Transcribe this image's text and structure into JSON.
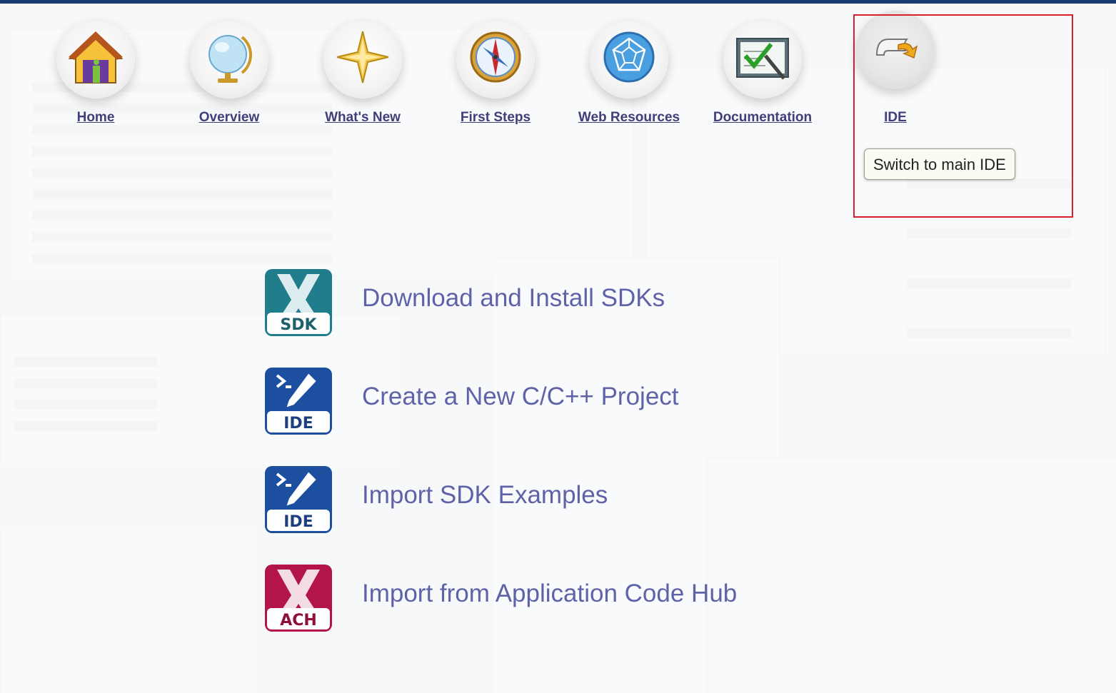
{
  "nav": {
    "items": [
      {
        "label": "Home",
        "icon": "home-icon"
      },
      {
        "label": "Overview",
        "icon": "globe-icon"
      },
      {
        "label": "What's New",
        "icon": "star-icon"
      },
      {
        "label": "First Steps",
        "icon": "compass-icon"
      },
      {
        "label": "Web Resources",
        "icon": "web-icon"
      },
      {
        "label": "Documentation",
        "icon": "documentation-icon"
      },
      {
        "label": "IDE",
        "icon": "switch-ide-icon"
      }
    ]
  },
  "tooltip": {
    "text": "Switch to main IDE"
  },
  "actions": {
    "items": [
      {
        "label": "Download and Install SDKs",
        "badge": "SDK",
        "icon": "sdk-icon",
        "color": "#1f7d8c"
      },
      {
        "label": "Create a New C/C++ Project",
        "badge": "IDE",
        "icon": "ide-icon",
        "color": "#1d4fa0"
      },
      {
        "label": "Import SDK Examples",
        "badge": "IDE",
        "icon": "ide-icon",
        "color": "#1d4fa0"
      },
      {
        "label": "Import from Application Code Hub",
        "badge": "ACH",
        "icon": "ach-icon",
        "color": "#b3154a"
      }
    ]
  },
  "colors": {
    "accent_bar": "#1b3b73",
    "highlight": "#d9202a",
    "link": "#3f3f7a",
    "action_text": "#5e63a8"
  }
}
